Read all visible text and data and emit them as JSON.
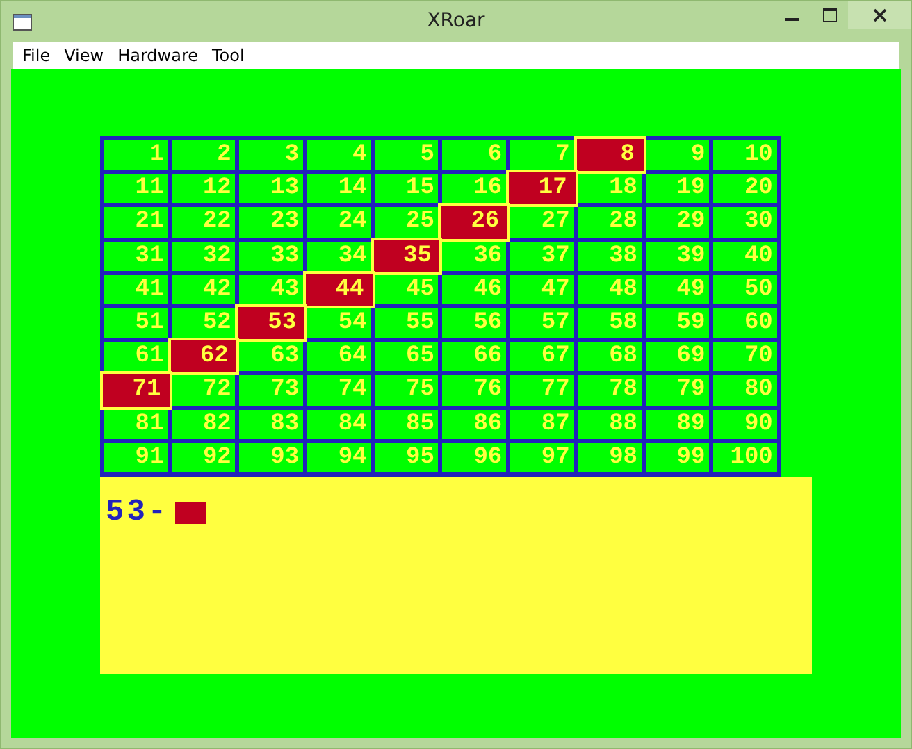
{
  "window": {
    "title": "XRoar"
  },
  "menu": [
    "File",
    "View",
    "Hardware",
    "Tool"
  ],
  "grid": {
    "rows": [
      [
        {
          "text": "1",
          "highlighted": false
        },
        {
          "text": "2",
          "highlighted": false
        },
        {
          "text": "3",
          "highlighted": false
        },
        {
          "text": "4",
          "highlighted": false
        },
        {
          "text": "5",
          "highlighted": false
        },
        {
          "text": "6",
          "highlighted": false
        },
        {
          "text": "7",
          "highlighted": false
        },
        {
          "text": "8",
          "highlighted": true
        },
        {
          "text": "9",
          "highlighted": false
        },
        {
          "text": "10",
          "highlighted": false
        }
      ],
      [
        {
          "text": "11",
          "highlighted": false
        },
        {
          "text": "12",
          "highlighted": false
        },
        {
          "text": "13",
          "highlighted": false
        },
        {
          "text": "14",
          "highlighted": false
        },
        {
          "text": "15",
          "highlighted": false
        },
        {
          "text": "16",
          "highlighted": false
        },
        {
          "text": "17",
          "highlighted": true
        },
        {
          "text": "18",
          "highlighted": false
        },
        {
          "text": "19",
          "highlighted": false
        },
        {
          "text": "20",
          "highlighted": false
        }
      ],
      [
        {
          "text": "21",
          "highlighted": false
        },
        {
          "text": "22",
          "highlighted": false
        },
        {
          "text": "23",
          "highlighted": false
        },
        {
          "text": "24",
          "highlighted": false
        },
        {
          "text": "25",
          "highlighted": false
        },
        {
          "text": "26",
          "highlighted": true
        },
        {
          "text": "27",
          "highlighted": false
        },
        {
          "text": "28",
          "highlighted": false
        },
        {
          "text": "29",
          "highlighted": false
        },
        {
          "text": "30",
          "highlighted": false
        }
      ],
      [
        {
          "text": "31",
          "highlighted": false
        },
        {
          "text": "32",
          "highlighted": false
        },
        {
          "text": "33",
          "highlighted": false
        },
        {
          "text": "34",
          "highlighted": false
        },
        {
          "text": "35",
          "highlighted": true
        },
        {
          "text": "36",
          "highlighted": false
        },
        {
          "text": "37",
          "highlighted": false
        },
        {
          "text": "38",
          "highlighted": false
        },
        {
          "text": "39",
          "highlighted": false
        },
        {
          "text": "40",
          "highlighted": false
        }
      ],
      [
        {
          "text": "41",
          "highlighted": false
        },
        {
          "text": "42",
          "highlighted": false
        },
        {
          "text": "43",
          "highlighted": false
        },
        {
          "text": "44",
          "highlighted": true
        },
        {
          "text": "45",
          "highlighted": false
        },
        {
          "text": "46",
          "highlighted": false
        },
        {
          "text": "47",
          "highlighted": false
        },
        {
          "text": "48",
          "highlighted": false
        },
        {
          "text": "49",
          "highlighted": false
        },
        {
          "text": "50",
          "highlighted": false
        }
      ],
      [
        {
          "text": "51",
          "highlighted": false
        },
        {
          "text": "52",
          "highlighted": false
        },
        {
          "text": "53",
          "highlighted": true
        },
        {
          "text": "54",
          "highlighted": false
        },
        {
          "text": "55",
          "highlighted": false
        },
        {
          "text": "56",
          "highlighted": false
        },
        {
          "text": "57",
          "highlighted": false
        },
        {
          "text": "58",
          "highlighted": false
        },
        {
          "text": "59",
          "highlighted": false
        },
        {
          "text": "60",
          "highlighted": false
        }
      ],
      [
        {
          "text": "61",
          "highlighted": false
        },
        {
          "text": "62",
          "highlighted": true
        },
        {
          "text": "63",
          "highlighted": false
        },
        {
          "text": "64",
          "highlighted": false
        },
        {
          "text": "65",
          "highlighted": false
        },
        {
          "text": "66",
          "highlighted": false
        },
        {
          "text": "67",
          "highlighted": false
        },
        {
          "text": "68",
          "highlighted": false
        },
        {
          "text": "69",
          "highlighted": false
        },
        {
          "text": "70",
          "highlighted": false
        }
      ],
      [
        {
          "text": "71",
          "highlighted": true
        },
        {
          "text": "72",
          "highlighted": false
        },
        {
          "text": "73",
          "highlighted": false
        },
        {
          "text": "74",
          "highlighted": false
        },
        {
          "text": "75",
          "highlighted": false
        },
        {
          "text": "76",
          "highlighted": false
        },
        {
          "text": "77",
          "highlighted": false
        },
        {
          "text": "78",
          "highlighted": false
        },
        {
          "text": "79",
          "highlighted": false
        },
        {
          "text": "80",
          "highlighted": false
        }
      ],
      [
        {
          "text": "81",
          "highlighted": false
        },
        {
          "text": "82",
          "highlighted": false
        },
        {
          "text": "83",
          "highlighted": false
        },
        {
          "text": "84",
          "highlighted": false
        },
        {
          "text": "85",
          "highlighted": false
        },
        {
          "text": "86",
          "highlighted": false
        },
        {
          "text": "87",
          "highlighted": false
        },
        {
          "text": "88",
          "highlighted": false
        },
        {
          "text": "89",
          "highlighted": false
        },
        {
          "text": "90",
          "highlighted": false
        }
      ],
      [
        {
          "text": "91",
          "highlighted": false
        },
        {
          "text": "92",
          "highlighted": false
        },
        {
          "text": "93",
          "highlighted": false
        },
        {
          "text": "94",
          "highlighted": false
        },
        {
          "text": "95",
          "highlighted": false
        },
        {
          "text": "96",
          "highlighted": false
        },
        {
          "text": "97",
          "highlighted": false
        },
        {
          "text": "98",
          "highlighted": false
        },
        {
          "text": "99",
          "highlighted": false
        },
        {
          "text": "100",
          "highlighted": false
        }
      ]
    ]
  },
  "console": {
    "prompt": "53-",
    "cursor": true
  }
}
